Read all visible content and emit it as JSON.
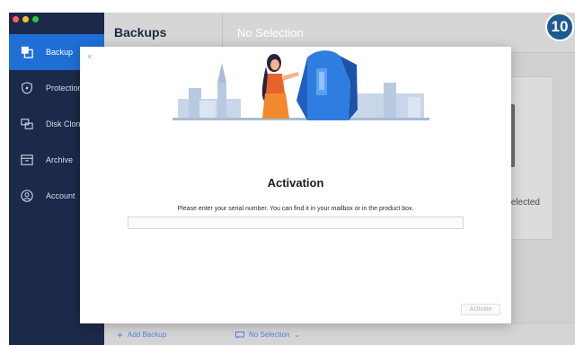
{
  "sidebar": {
    "items": [
      {
        "label": "Backup",
        "icon": "backup-copy-icon",
        "active": true
      },
      {
        "label": "Protection",
        "icon": "shield-icon",
        "active": false
      },
      {
        "label": "Disk Clone",
        "icon": "disk-clone-icon",
        "active": false
      },
      {
        "label": "Archive",
        "icon": "archive-box-icon",
        "active": false
      },
      {
        "label": "Account",
        "icon": "user-circle-icon",
        "active": false
      }
    ]
  },
  "header": {
    "backups_title": "Backups",
    "no_selection_title": "No Selection"
  },
  "destination": {
    "label": "elected"
  },
  "footer": {
    "add_backup": "Add Backup",
    "no_selection": "No Selection"
  },
  "modal": {
    "close": "×",
    "title": "Activation",
    "instruction": "Please enter your serial number. You can find it in your mailbox or in the product box.",
    "serial_value": "",
    "activate_label": "Activate"
  },
  "badge": {
    "text": "10"
  },
  "colors": {
    "sidebar_bg": "#1b2a4a",
    "active_item": "#1f6fd6",
    "badge": "#1e5a8e",
    "link_blue": "#4b86d8"
  }
}
